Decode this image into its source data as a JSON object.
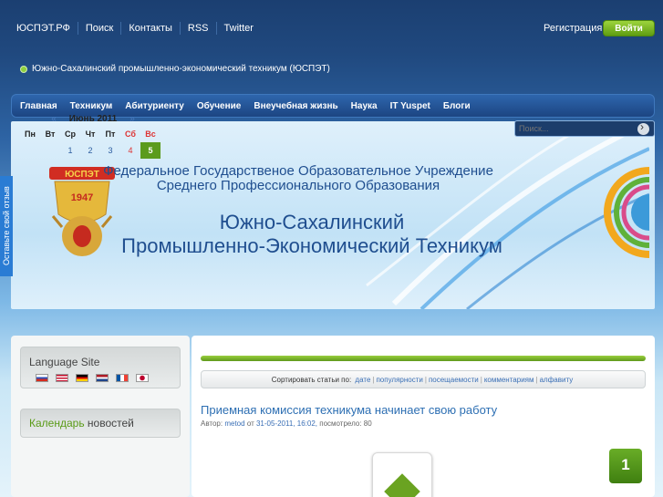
{
  "topnav": [
    "ЮСПЭТ.РФ",
    "Поиск",
    "Контакты",
    "RSS",
    "Twitter"
  ],
  "auth": {
    "register": "Регистрация",
    "login": "Войти"
  },
  "breadcrumb": "Южно-Сахалинский промышленно-экономический техникум (ЮСПЭТ)",
  "menu": [
    "Главная",
    "Техникум",
    "Абитуриенту",
    "Обучение",
    "Внеучебная жизнь",
    "Наука",
    "IT Yuspet",
    "Блоги"
  ],
  "search": {
    "placeholder": "Поиск..."
  },
  "banner": {
    "line1": "Федеральное Государственое Образовательное Учреждение",
    "line2": "Среднего Профессионального Образования",
    "line3": "Южно-Сахалинский",
    "line4": "Промышленно-Экономический Техникум",
    "emblem_text": "ЮСПЭТ",
    "emblem_year": "1947"
  },
  "feedback": "Оставьте свой отзыв",
  "sidebar": {
    "language_title": "Language Site",
    "flags": [
      "ru",
      "us",
      "de",
      "nl",
      "fr",
      "jp"
    ],
    "calendar_title_green": "Календарь",
    "calendar_title_rest": " новостей",
    "calendar": {
      "prev": "«",
      "month": "Июнь 2011",
      "next": "»",
      "dow": [
        "Пн",
        "Вт",
        "Ср",
        "Чт",
        "Пт",
        "Сб",
        "Вс"
      ],
      "first_row": [
        "",
        "",
        "1",
        "2",
        "3",
        "4",
        "5"
      ]
    }
  },
  "content": {
    "sort_label": "Сортировать статьи по:",
    "sort_options": [
      "дате",
      "популярности",
      "посещаемости",
      "комментариям",
      "алфавиту"
    ],
    "article_title": "Приемная комиссия техникума начинает свою работу",
    "meta_prefix": "Автор:",
    "meta_author": "metod",
    "meta_from": "от",
    "meta_date": "31-05-2011, 16:02,",
    "meta_views": "посмотрело: 80",
    "badge": "1"
  },
  "colors": {
    "accent_green": "#5b9b1d",
    "link_blue": "#2d6fb3",
    "menu_blue": "#2e66ad"
  }
}
